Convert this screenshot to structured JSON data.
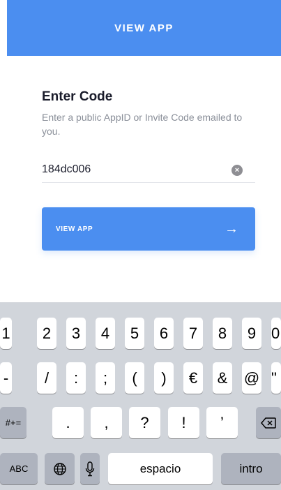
{
  "header": {
    "title": "VIEW APP"
  },
  "form": {
    "title": "Enter Code",
    "subtitle": "Enter a public AppID or Invite Code emailed to you.",
    "code_value": "184dc006",
    "clear_icon": "clear-icon",
    "button_label": "VIEW APP",
    "button_icon": "arrow-right-icon",
    "accent_color": "#4b8ef0"
  },
  "keyboard": {
    "row1": [
      "1",
      "2",
      "3",
      "4",
      "5",
      "6",
      "7",
      "8",
      "9",
      "0"
    ],
    "row2": [
      "-",
      "/",
      ":",
      ";",
      "(",
      ")",
      "€",
      "&",
      "@",
      "\""
    ],
    "row3_shift": "#+=",
    "row3": [
      ".",
      ",",
      "?",
      "!",
      "’"
    ],
    "backspace_icon": "backspace-icon",
    "abc": "ABC",
    "globe_icon": "globe-icon",
    "mic_icon": "microphone-icon",
    "space": "espacio",
    "return": "intro"
  }
}
